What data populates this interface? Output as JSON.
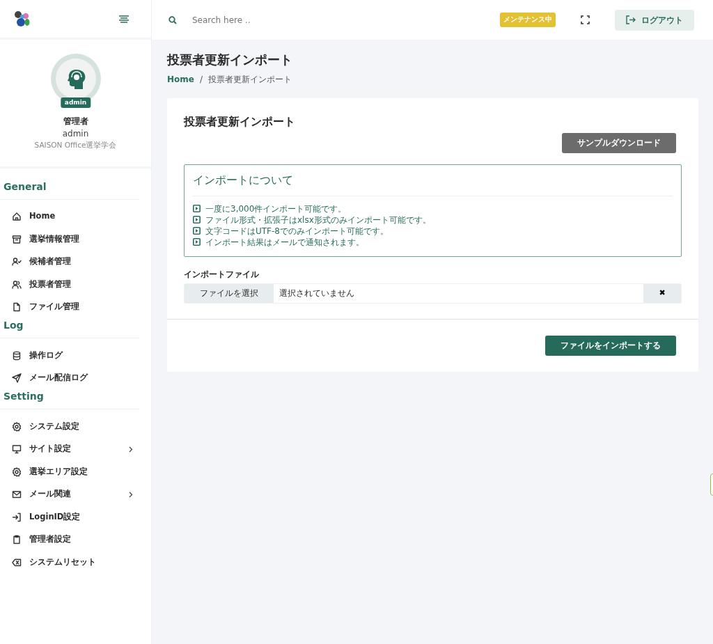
{
  "topbar": {
    "search": {
      "placeholder": "Search here .."
    },
    "maintenance_badge": "メンテナンス中",
    "logout_button": "ログアウト"
  },
  "profile": {
    "badge": "admin",
    "name": "管理者",
    "username": "admin",
    "organization": "SAISON Office選挙学会"
  },
  "sidebar": {
    "sections": [
      {
        "title": "General",
        "items": [
          {
            "label": "Home",
            "has_submenu": false
          },
          {
            "label": "選挙情報管理",
            "has_submenu": false
          },
          {
            "label": "候補者管理",
            "has_submenu": false
          },
          {
            "label": "投票者管理",
            "has_submenu": false
          },
          {
            "label": "ファイル管理",
            "has_submenu": false
          }
        ]
      },
      {
        "title": "Log",
        "items": [
          {
            "label": "操作ログ",
            "has_submenu": false
          },
          {
            "label": "メール配信ログ",
            "has_submenu": false
          }
        ]
      },
      {
        "title": "Setting",
        "items": [
          {
            "label": "システム設定",
            "has_submenu": false
          },
          {
            "label": "サイト設定",
            "has_submenu": true
          },
          {
            "label": "選挙エリア設定",
            "has_submenu": false
          },
          {
            "label": "メール関連",
            "has_submenu": true
          },
          {
            "label": "LoginID設定",
            "has_submenu": false
          },
          {
            "label": "管理者設定",
            "has_submenu": false
          },
          {
            "label": "システムリセット",
            "has_submenu": false
          }
        ]
      }
    ]
  },
  "page": {
    "title": "投票者更新インポート",
    "breadcrumb_separator": "/",
    "breadcrumb": [
      {
        "label": "Home"
      },
      {
        "label": "投票者更新インポート"
      }
    ]
  },
  "card": {
    "title": "投票者更新インポート",
    "sample_button": "サンプルダウンロード",
    "info": {
      "title": "インポートについて",
      "items": [
        "一度に3,000件インポート可能です。",
        "ファイル形式・拡張子はxlsx形式のみインポート可能です。",
        "文字コードはUTF-8でのみインポート可能です。",
        "インポート結果はメールで通知されます。"
      ]
    },
    "file_label": "インポートファイル",
    "file_button": "ファイルを選択",
    "file_status": "選択されていません",
    "clear_button": "✖",
    "submit_button": "ファイルをインポートする"
  }
}
